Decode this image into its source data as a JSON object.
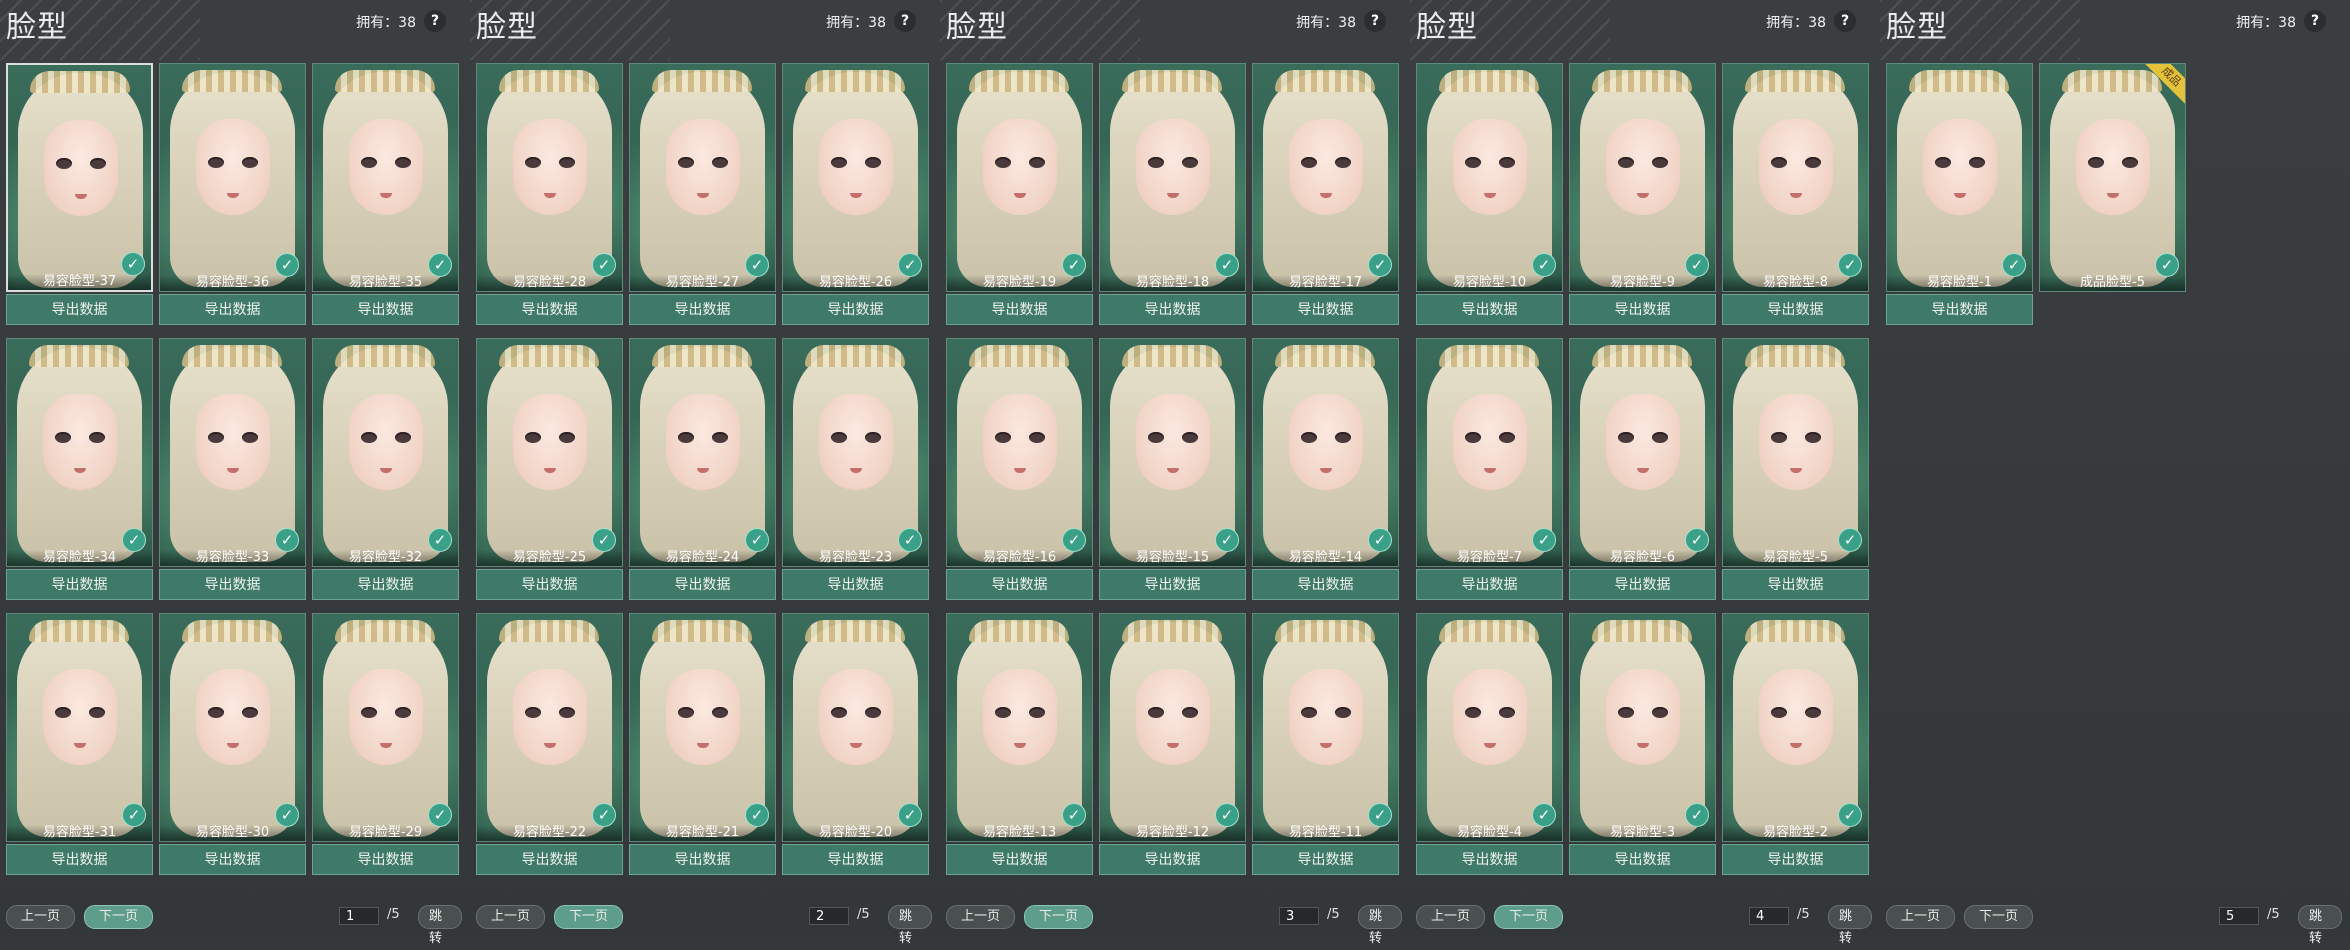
{
  "title": "脸型",
  "owned": "拥有：38",
  "help": "?",
  "export_label": "导出数据",
  "prev_label": "上一页",
  "next_label": "下一页",
  "jump_label": "跳转",
  "total_pages": "/5",
  "badge_text": "成品",
  "colors": {
    "accent": "#3f7a69",
    "check": "#3aa088",
    "badge": "#e3c23a"
  },
  "pages": [
    {
      "page": "1",
      "active_nav": "next",
      "items": [
        "易容脸型-37",
        "易容脸型-36",
        "易容脸型-35",
        "易容脸型-34",
        "易容脸型-33",
        "易容脸型-32",
        "易容脸型-31",
        "易容脸型-30",
        "易容脸型-29"
      ]
    },
    {
      "page": "2",
      "active_nav": "next",
      "items": [
        "易容脸型-28",
        "易容脸型-27",
        "易容脸型-26",
        "易容脸型-25",
        "易容脸型-24",
        "易容脸型-23",
        "易容脸型-22",
        "易容脸型-21",
        "易容脸型-20"
      ]
    },
    {
      "page": "3",
      "active_nav": "next",
      "items": [
        "易容脸型-19",
        "易容脸型-18",
        "易容脸型-17",
        "易容脸型-16",
        "易容脸型-15",
        "易容脸型-14",
        "易容脸型-13",
        "易容脸型-12",
        "易容脸型-11"
      ]
    },
    {
      "page": "4",
      "active_nav": "next",
      "items": [
        "易容脸型-10",
        "易容脸型-9",
        "易容脸型-8",
        "易容脸型-7",
        "易容脸型-6",
        "易容脸型-5",
        "易容脸型-4",
        "易容脸型-3",
        "易容脸型-2"
      ]
    },
    {
      "page": "5",
      "active_nav": "none",
      "items": [
        "易容脸型-1",
        "成品脸型-5"
      ]
    }
  ]
}
